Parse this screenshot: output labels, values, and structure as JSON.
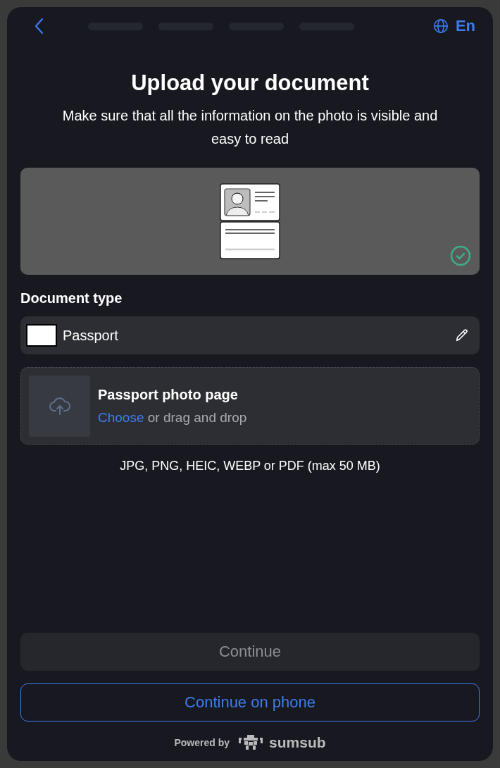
{
  "header": {
    "language": "En"
  },
  "title": "Upload your document",
  "subtitle": "Make sure that all the information on the photo is visible and easy to read",
  "preview": {
    "verified": true
  },
  "document_type": {
    "label": "Document type",
    "value": "Passport"
  },
  "upload": {
    "title": "Passport photo page",
    "link": "Choose",
    "hint": "or drag and drop"
  },
  "formats": "JPG, PNG, HEIC, WEBP or PDF (max 50 MB)",
  "buttons": [
    {
      "label": "Continue",
      "kind": "primary",
      "disabled": true
    },
    {
      "label": "Continue on phone",
      "kind": "outline",
      "disabled": false
    }
  ],
  "footer": {
    "powered_by": "Powered by",
    "brand": "sumsub"
  }
}
